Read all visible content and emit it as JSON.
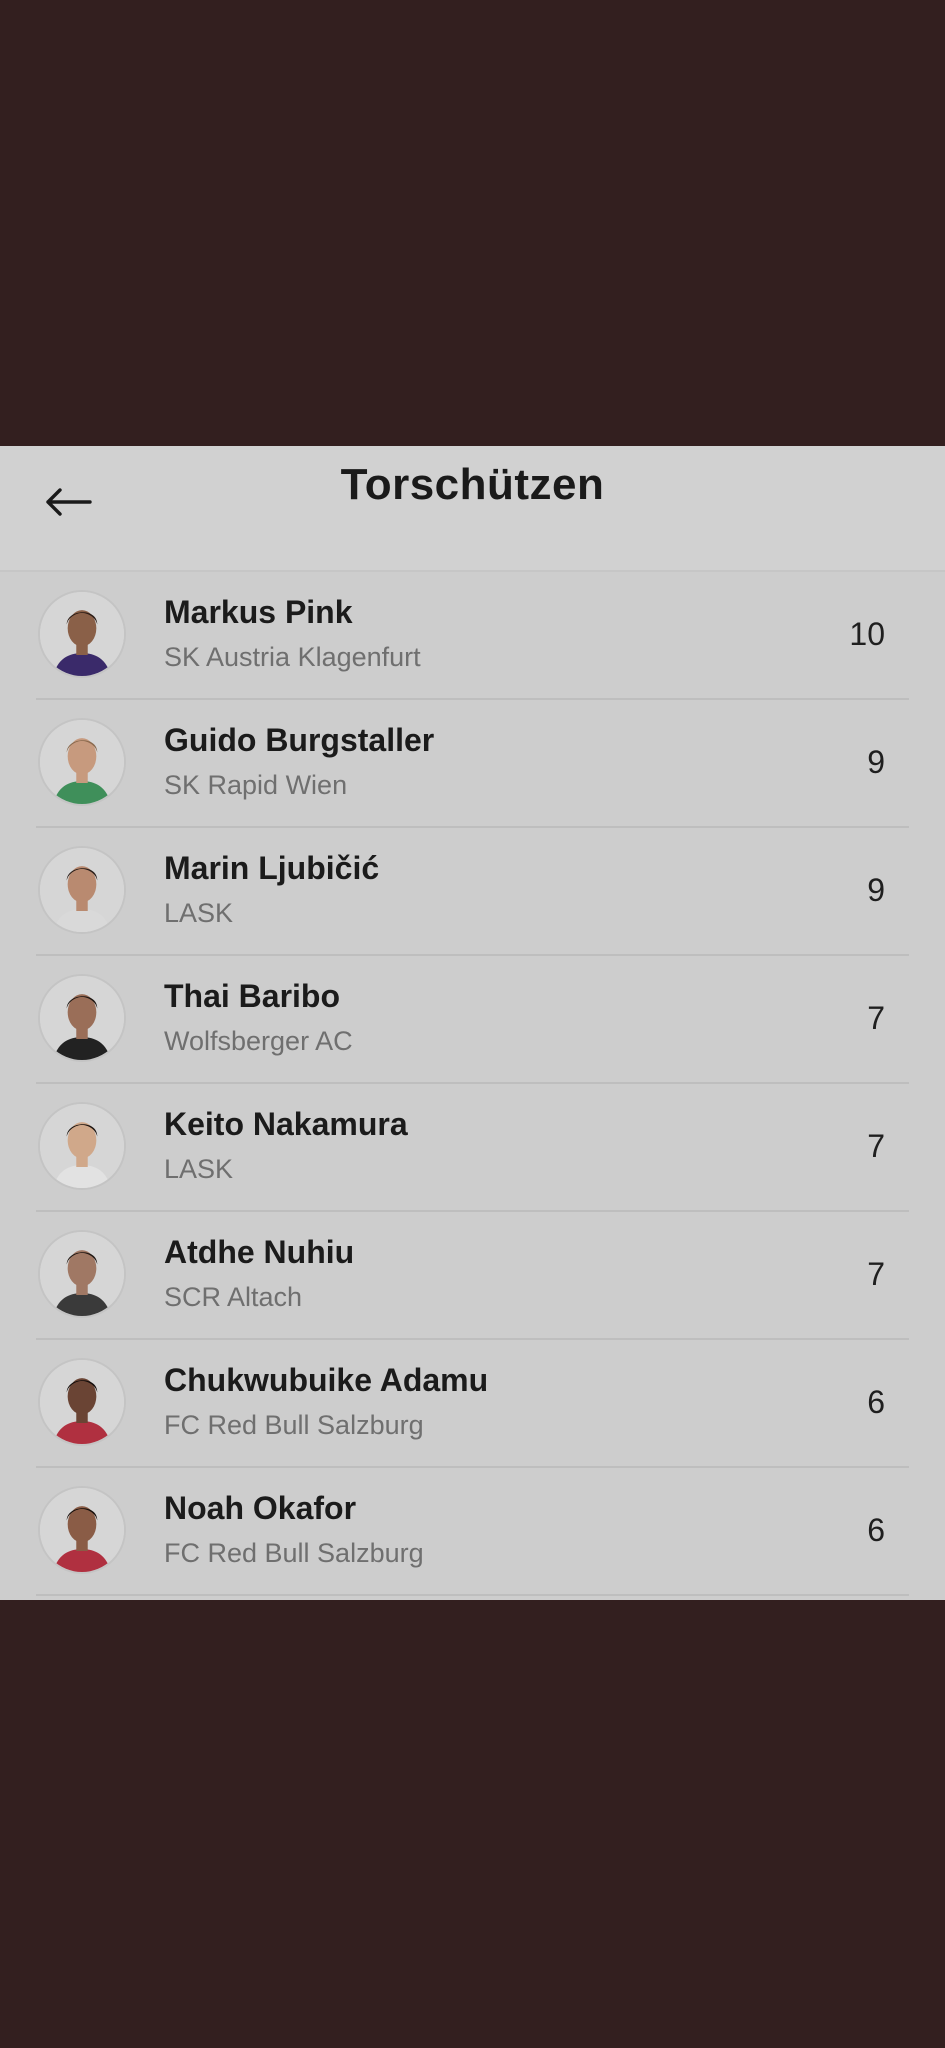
{
  "header": {
    "title": "Torschützen",
    "back_icon": "arrow-left-icon"
  },
  "players": [
    {
      "name": "Markus Pink",
      "team": "SK Austria Klagenfurt",
      "goals": "10",
      "skin": "#8a6048",
      "hair": "#2a1c16",
      "shirt": "#3a2a6a"
    },
    {
      "name": "Guido Burgstaller",
      "team": "SK Rapid Wien",
      "goals": "9",
      "skin": "#c79a7e",
      "hair": "#8a6a4e",
      "shirt": "#3f8f5a"
    },
    {
      "name": "Marin Ljubičić",
      "team": "LASK",
      "goals": "9",
      "skin": "#b98a70",
      "hair": "#2b1f1a",
      "shirt": "#d9d9d9"
    },
    {
      "name": "Thai Baribo",
      "team": "Wolfsberger AC",
      "goals": "7",
      "skin": "#9a6e58",
      "hair": "#1e1612",
      "shirt": "#222222"
    },
    {
      "name": "Keito Nakamura",
      "team": "LASK",
      "goals": "7",
      "skin": "#d0a88a",
      "hair": "#1c1410",
      "shirt": "#e2e2e2"
    },
    {
      "name": "Atdhe Nuhiu",
      "team": "SCR Altach",
      "goals": "7",
      "skin": "#a07864",
      "hair": "#201814",
      "shirt": "#3a3a3a"
    },
    {
      "name": "Chukwubuike Adamu",
      "team": "FC Red Bull Salzburg",
      "goals": "6",
      "skin": "#6a4434",
      "hair": "#140e0c",
      "shirt": "#b03040"
    },
    {
      "name": "Noah Okafor",
      "team": "FC Red Bull Salzburg",
      "goals": "6",
      "skin": "#8a5c46",
      "hair": "#18100c",
      "shirt": "#b03040"
    }
  ]
}
